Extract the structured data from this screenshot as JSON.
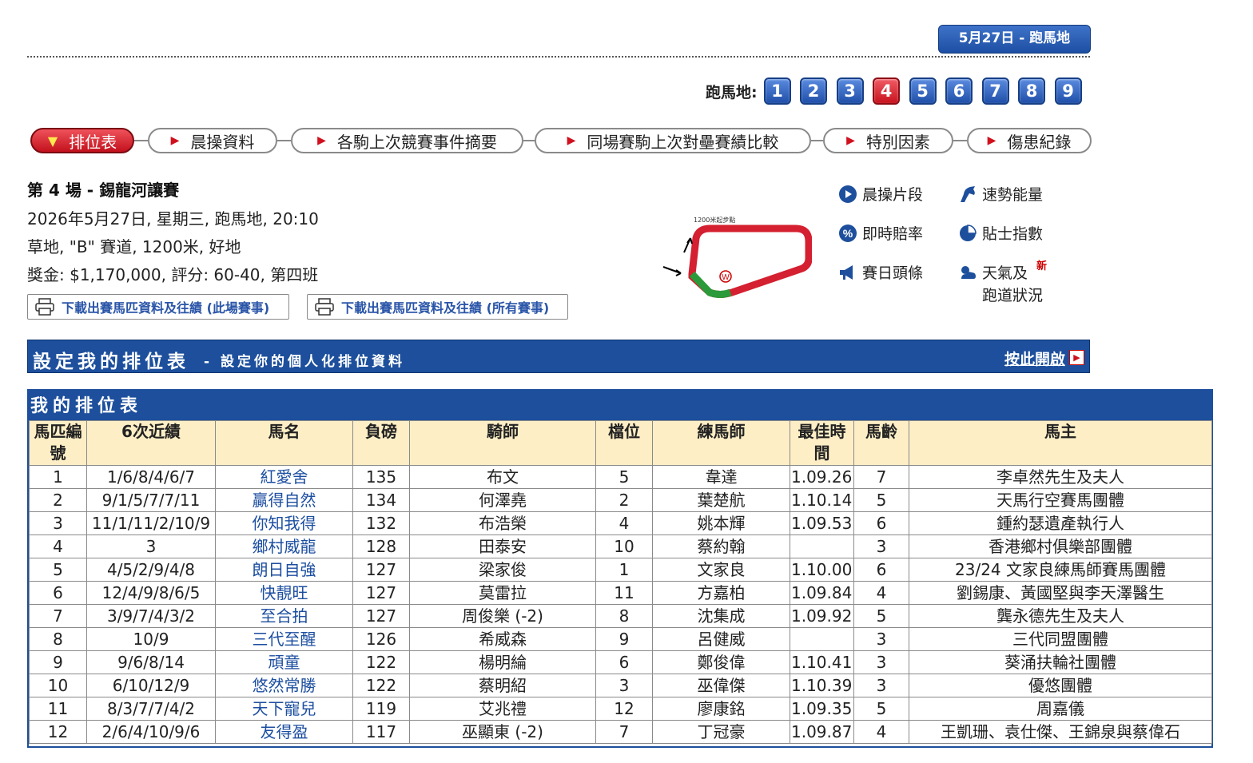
{
  "date_badge": "5月27日 - 跑馬地",
  "race_nav": {
    "label": "跑馬地:",
    "races": [
      "1",
      "2",
      "3",
      "4",
      "5",
      "6",
      "7",
      "8",
      "9"
    ],
    "active": "4"
  },
  "tabs": [
    {
      "label": "排位表",
      "active": true
    },
    {
      "label": "晨操資料",
      "active": false
    },
    {
      "label": "各駒上次競賽事件摘要",
      "active": false
    },
    {
      "label": "同場賽駒上次對壘賽績比較",
      "active": false
    },
    {
      "label": "特別因素",
      "active": false
    },
    {
      "label": "傷患紀錄",
      "active": false
    }
  ],
  "race": {
    "title": "第 4 場 - 錫龍河讓賽",
    "line1": "2026年5月27日, 星期三, 跑馬地, 20:10",
    "line2": "草地, \"B\" 賽道, 1200米, 好地",
    "line3": "獎金: $1,170,000, 評分: 60-40, 第四班"
  },
  "downloads": {
    "this_race": "下載出賽馬匹資料及往績 (此場賽事)",
    "all_races": "下載出賽馬匹資料及往績 (所有賽事)"
  },
  "track_label": "1200米起步點",
  "quick_links": {
    "trackwork_video": "晨操片段",
    "speed_pro": "速勢能量",
    "live_odds": "即時賠率",
    "tips_index": "貼士指數",
    "raceday_news": "賽日頭條",
    "weather_line1": "天氣及",
    "weather_line2": "跑道狀況",
    "new": "新"
  },
  "banner": {
    "title": "設定我的排位表",
    "subtitle": "- 設定你的個人化排位資料",
    "link": "按此開啟"
  },
  "table": {
    "caption": "我的排位表",
    "headers": [
      "馬匹編號",
      "6次近績",
      "馬名",
      "負磅",
      "騎師",
      "檔位",
      "練馬師",
      "最佳時間",
      "馬齡",
      "馬主"
    ],
    "rows": [
      [
        "1",
        "1/6/8/4/6/7",
        "紅愛舍",
        "135",
        "布文",
        "5",
        "韋達",
        "1.09.26",
        "7",
        "李卓然先生及夫人"
      ],
      [
        "2",
        "9/1/5/7/7/11",
        "贏得自然",
        "134",
        "何澤堯",
        "2",
        "葉楚航",
        "1.10.14",
        "5",
        "天馬行空賽馬團體"
      ],
      [
        "3",
        "11/1/11/2/10/9",
        "你知我得",
        "132",
        "布浩榮",
        "4",
        "姚本輝",
        "1.09.53",
        "6",
        "鍾約瑟遺產執行人"
      ],
      [
        "4",
        "3",
        "鄉村威龍",
        "128",
        "田泰安",
        "10",
        "蔡約翰",
        "",
        "3",
        "香港鄉村俱樂部團體"
      ],
      [
        "5",
        "4/5/2/9/4/8",
        "朗日自強",
        "127",
        "梁家俊",
        "1",
        "文家良",
        "1.10.00",
        "6",
        "23/24 文家良練馬師賽馬團體"
      ],
      [
        "6",
        "12/4/9/8/6/5",
        "快靚旺",
        "127",
        "莫雷拉",
        "11",
        "方嘉柏",
        "1.09.84",
        "4",
        "劉錫康、黃國堅與李天澤醫生"
      ],
      [
        "7",
        "3/9/7/4/3/2",
        "至合拍",
        "127",
        "周俊樂 (-2)",
        "8",
        "沈集成",
        "1.09.92",
        "5",
        "龔永德先生及夫人"
      ],
      [
        "8",
        "10/9",
        "三代至醒",
        "126",
        "希威森",
        "9",
        "呂健威",
        "",
        "3",
        "三代同盟團體"
      ],
      [
        "9",
        "9/6/8/14",
        "頑童",
        "122",
        "楊明綸",
        "6",
        "鄭俊偉",
        "1.10.41",
        "3",
        "葵涌扶輪社團體"
      ],
      [
        "10",
        "6/10/12/9",
        "悠然常勝",
        "122",
        "蔡明紹",
        "3",
        "巫偉傑",
        "1.10.39",
        "3",
        "優悠團體"
      ],
      [
        "11",
        "8/3/7/7/4/2",
        "天下寵兒",
        "119",
        "艾兆禮",
        "12",
        "廖康銘",
        "1.09.35",
        "5",
        "周嘉儀"
      ],
      [
        "12",
        "2/6/4/10/9/6",
        "友得盈",
        "117",
        "巫顯東 (-2)",
        "7",
        "丁冠豪",
        "1.09.87",
        "4",
        "王凱珊、袁仕傑、王錦泉與蔡偉石"
      ]
    ]
  }
}
